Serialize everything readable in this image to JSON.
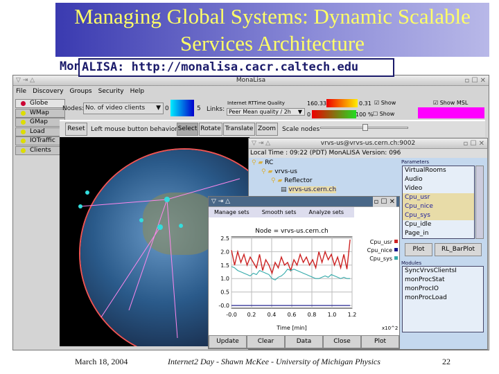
{
  "slide": {
    "title": "Managing Global Systems: Dynamic Scalable Services Architecture",
    "url_prefix": "Mon",
    "url_text": "ALISA:  http://monalisa.cacr.caltech.edu",
    "footer": {
      "date": "March 18, 2004",
      "center": "Internet2 Day - Shawn McKee - University of Michigan Physics",
      "page": "22"
    }
  },
  "main_window": {
    "title": "MonaLisa",
    "menu": [
      "File",
      "Discovery",
      "Groups",
      "Security",
      "Help"
    ],
    "tabs": [
      {
        "label": "Globe",
        "color": "#cc0033"
      },
      {
        "label": "WMap",
        "color": "#dddd00"
      },
      {
        "label": "GMap",
        "color": "#dddd00"
      },
      {
        "label": "Load",
        "color": "#dddd00"
      },
      {
        "label": "IOTraffic",
        "color": "#dddd00"
      },
      {
        "label": "Clients",
        "color": "#dddd00"
      }
    ],
    "nodes_label": "Nodes:",
    "nodes_select": "No. of video clients",
    "nodes_min": "0",
    "nodes_max": "5",
    "links_label": "Links:",
    "links_title": "Internet RTTime Quality",
    "links_select": "Peer Mean quality / 2h",
    "scale1_min": "160.33",
    "scale1_max": "0.31",
    "scale2_min": "0",
    "scale2_max": "100 %",
    "show": "Show",
    "show1_checked": true,
    "show2_checked": false,
    "show_msl": "Show MSL",
    "show_msl_checked": true,
    "toolbar": {
      "reset": "Reset",
      "behavior": "Left mouse button behavior:",
      "select": "Select",
      "rotate": "Rotate",
      "translate": "Translate",
      "zoom": "Zoom",
      "scale_nodes": "Scale nodes"
    },
    "scale_slider_value": 0.5
  },
  "node_window": {
    "title": "vrvs-us@vrvs-us.cern.ch:9002",
    "local_time": "Local Time : 09:22 (PDT)   MonALISA Version: 096",
    "tree": [
      "RC",
      "vrvs-us",
      "Reflector",
      "vrvs-us.cern.ch"
    ],
    "parameters_label": "Parameters",
    "parameters": [
      "VirtualRooms",
      "Audio",
      "Video",
      "Cpu_usr",
      "Cpu_nice",
      "Cpu_sys",
      "Cpu_idle",
      "Page_in"
    ],
    "selected": [
      "Cpu_usr",
      "Cpu_nice",
      "Cpu_sys"
    ],
    "plot_button": "Plot",
    "barplot_button": "RL_BarPlot",
    "modules_label": "Modules",
    "modules": [
      "SyncVrvsClientsI",
      "monProcStat",
      "monProcIO",
      "monProcLoad"
    ]
  },
  "plot_window": {
    "menu": [
      "Manage sets",
      "Smooth sets",
      "Analyze sets"
    ],
    "buttons": [
      "Update",
      "Clear",
      "Data",
      "Close",
      "Plot"
    ],
    "chart_data": {
      "type": "line",
      "title": "Node = vrvs-us.cern.ch",
      "xlabel": "Time [min]",
      "x_multiplier": "x10^2",
      "xlim": [
        0,
        1.2
      ],
      "ylim": [
        -0.1,
        2.55
      ],
      "xticks": [
        "-0.0",
        "0.2",
        "0.4",
        "0.6",
        "0.8",
        "1.0",
        "1.2"
      ],
      "yticks": [
        "2.5",
        "2.0",
        "1.5",
        "1.0",
        "0.5",
        "-0.0"
      ],
      "legend_position": "right",
      "series": [
        {
          "name": "Cpu_usr",
          "color": "#cc2222",
          "values": [
            2.05,
            1.5,
            2.0,
            1.6,
            1.9,
            1.5,
            1.8,
            1.6,
            1.4,
            1.9,
            1.3,
            1.7,
            1.5,
            1.2,
            1.6,
            1.4,
            1.8,
            1.5,
            1.6,
            1.3,
            1.7,
            1.5,
            1.9,
            1.6,
            1.8,
            1.5,
            1.7,
            1.4,
            2.0,
            1.6,
            2.0,
            1.7,
            1.9,
            1.5,
            1.8,
            1.4,
            1.9,
            1.35,
            2.45
          ]
        },
        {
          "name": "Cpu_nice",
          "color": "#111188",
          "values": [
            0,
            0,
            0,
            0,
            0,
            0,
            0,
            0,
            0,
            0,
            0,
            0,
            0,
            0,
            0,
            0,
            0,
            0,
            0,
            0,
            0,
            0,
            0,
            0,
            0,
            0,
            0,
            0,
            0,
            0,
            0,
            0,
            0,
            0,
            0,
            0,
            0,
            0,
            0
          ]
        },
        {
          "name": "Cpu_sys",
          "color": "#33aaaa",
          "values": [
            1.45,
            1.4,
            1.3,
            1.25,
            1.2,
            1.15,
            1.1,
            1.2,
            1.15,
            1.3,
            1.25,
            1.2,
            1.15,
            1.0,
            0.95,
            1.05,
            1.1,
            1.2,
            1.35,
            1.3,
            1.35,
            1.3,
            1.25,
            1.2,
            1.15,
            1.1,
            1.05,
            1.0,
            1.0,
            1.05,
            1.1,
            1.05,
            1.15,
            1.1,
            1.05,
            1.0,
            1.05,
            1.0,
            1.0
          ]
        }
      ]
    }
  }
}
